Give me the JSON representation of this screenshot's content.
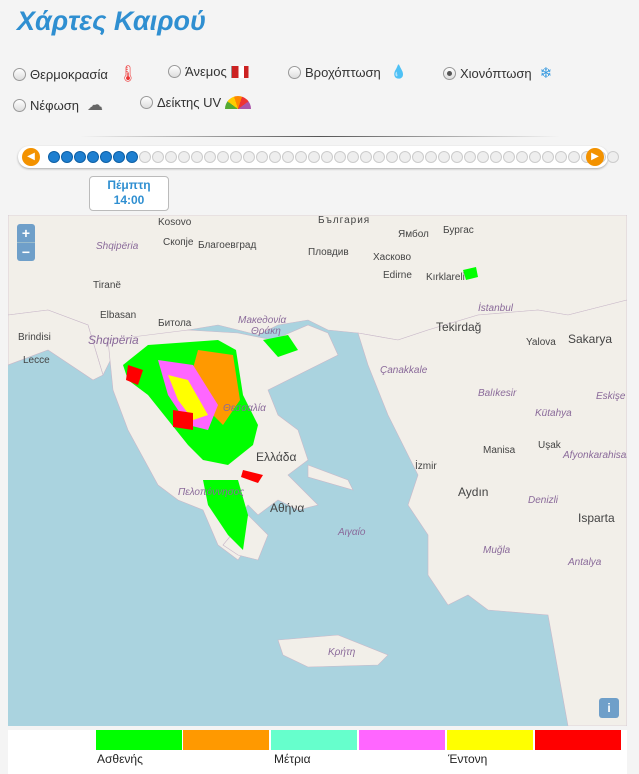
{
  "title": "Χάρτες Καιρού",
  "options": [
    {
      "label": "Θερμοκρασία",
      "icon": "thermometer-icon",
      "selected": false
    },
    {
      "label": "Άνεμος",
      "icon": "windsock-icon",
      "selected": false
    },
    {
      "label": "Βροχόπτωση",
      "icon": "raindrop-icon",
      "selected": false
    },
    {
      "label": "Χιονόπτωση",
      "icon": "snowflake-icon",
      "selected": true
    },
    {
      "label": "Νέφωση",
      "icon": "cloud-icon",
      "selected": false
    },
    {
      "label": "Δείκτης UV",
      "icon": "uv-gauge-icon",
      "selected": false
    }
  ],
  "timeline": {
    "day": "Πέμπτη",
    "time": "14:00",
    "steps_total": 44,
    "steps_active": 7
  },
  "map": {
    "zoom_in": "+",
    "zoom_out": "−",
    "info": "i",
    "labels": [
      "Κosovo",
      "България",
      "Скопје",
      "Благоевград",
      "Пловдив",
      "Ямбол",
      "Бургас",
      "Хасково",
      "Shqipëria",
      "Tiranë",
      "Edirne",
      "Kırklareli",
      "Elbasan",
      "Битола",
      "Македονία",
      "Θράκη",
      "Tekirdağ",
      "İstanbul",
      "Brindisi",
      "Shqipëria",
      "Yalova",
      "Sakarya",
      "Lecce",
      "Çanakkale",
      "Balıkesir",
      "Kütahya",
      "Eskişe",
      "Θεσσαλία",
      "Ελλάδα",
      "İzmir",
      "Manisa",
      "Uşak",
      "Afyonkarahisar",
      "Πελοπόννησος",
      "Αθήνα",
      "Aydın",
      "Denizli",
      "Isparta",
      "Αιγαίο",
      "Muğla",
      "Antalya",
      "Κρήτη"
    ],
    "land": "#f2efe9",
    "sea": "#aad3df"
  },
  "legend": {
    "colors": [
      "#00ff00",
      "#ff9900",
      "#66ffcc",
      "#ff66ff",
      "#ffff00",
      "#ff0000"
    ],
    "labels": [
      "Ασθενής",
      "Μέτρια",
      "Έντονη"
    ]
  }
}
